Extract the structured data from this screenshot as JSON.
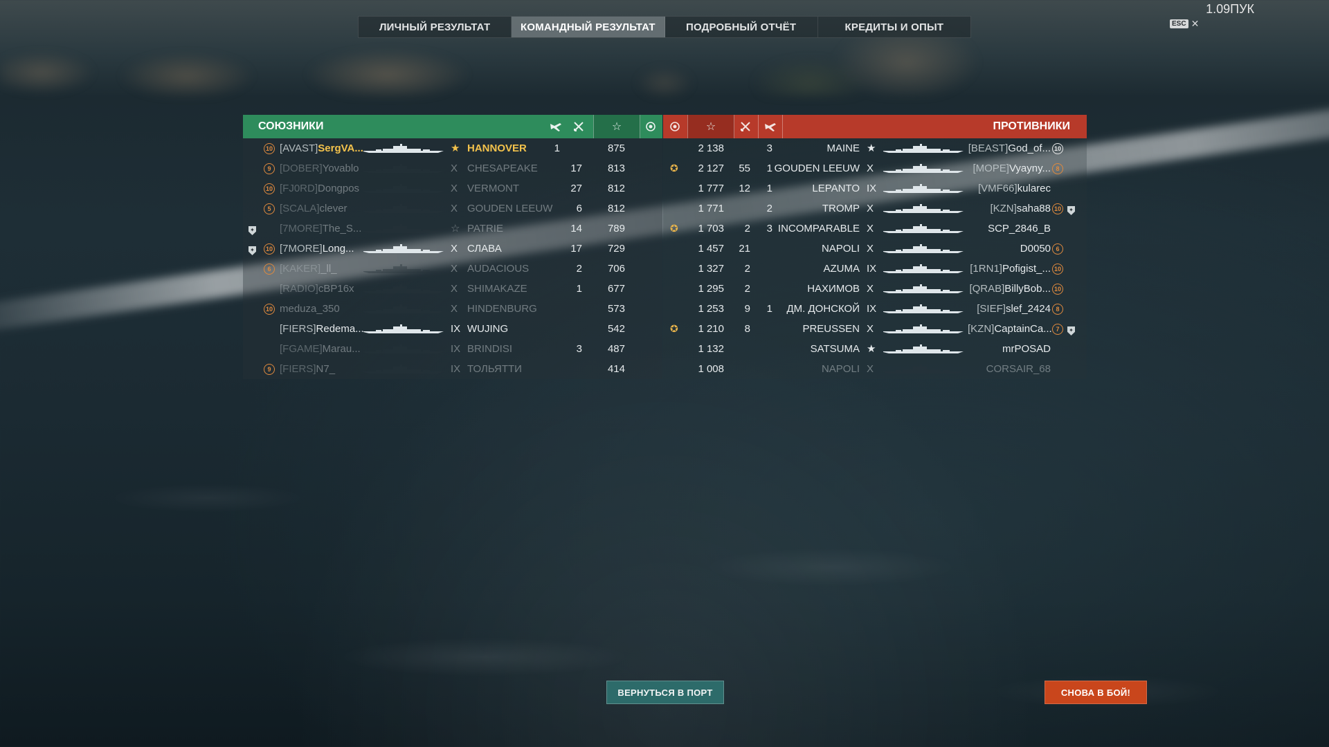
{
  "version": "1.09ПУК",
  "esc": {
    "label": "ESC",
    "close": "✕"
  },
  "tabs": [
    {
      "label": "ЛИЧНЫЙ РЕЗУЛЬТАТ",
      "active": false
    },
    {
      "label": "КОМАНДНЫЙ РЕЗУЛЬТАТ",
      "active": true
    },
    {
      "label": "ПОДРОБНЫЙ ОТЧЁТ",
      "active": false
    },
    {
      "label": "КРЕДИТЫ И ОПЫТ",
      "active": false
    }
  ],
  "allies": {
    "title": "СОЮЗНИКИ",
    "header_icons": [
      "plane-icon",
      "crossed-swords-icon",
      "star-icon",
      "wreath-icon"
    ],
    "rows": [
      {
        "level": "10",
        "clan": "[AVAST]",
        "name": "SergVA...",
        "tier": "★",
        "ship": "HANNOVER",
        "planes": "1",
        "kills": "",
        "xp": "875",
        "highlight": true,
        "alive": true
      },
      {
        "level": "9",
        "clan": "[DOBER]",
        "name": "Yovablo",
        "tier": "X",
        "ship": "CHESAPEAKE",
        "planes": "",
        "kills": "17",
        "xp": "813",
        "alive": false
      },
      {
        "level": "10",
        "clan": "[FJ0RD]",
        "name": "Dongpos",
        "tier": "X",
        "ship": "VERMONT",
        "planes": "",
        "kills": "27",
        "xp": "812",
        "alive": false
      },
      {
        "level": "5",
        "clan": "[SCALA]",
        "name": "clever",
        "tier": "X",
        "ship": "GOUDEN LEEUW",
        "planes": "",
        "kills": "6",
        "xp": "812",
        "alive": false
      },
      {
        "shield": true,
        "level": "",
        "clan": "[7MORE]",
        "name": "The_S...",
        "tier": "☆",
        "ship": "PATRIE",
        "planes": "",
        "kills": "14",
        "xp": "789",
        "alive": false
      },
      {
        "shield": true,
        "level": "10",
        "clan": "[7MORE]",
        "name": "Long...",
        "tier": "X",
        "ship": "СЛАВА",
        "planes": "",
        "kills": "17",
        "xp": "729",
        "alive": true
      },
      {
        "level": "6",
        "clan": "[KAKER]",
        "name": "_ll_",
        "tier": "X",
        "ship": "AUDACIOUS",
        "planes": "",
        "kills": "2",
        "xp": "706",
        "alive": false
      },
      {
        "level": "",
        "clan": "[RADIO]",
        "name": "cBP16x",
        "tier": "X",
        "ship": "SHIMAKAZE",
        "planes": "",
        "kills": "1",
        "xp": "677",
        "alive": false
      },
      {
        "level": "10",
        "clan": "",
        "name": "meduza_350",
        "tier": "X",
        "ship": "HINDENBURG",
        "planes": "",
        "kills": "",
        "xp": "573",
        "alive": false
      },
      {
        "level": "",
        "clan": "[FIERS]",
        "name": "Redema...",
        "tier": "IX",
        "ship": "WUJING",
        "planes": "",
        "kills": "",
        "xp": "542",
        "alive": true
      },
      {
        "level": "",
        "clan": "[FGAME]",
        "name": "Marau...",
        "tier": "IX",
        "ship": "BRINDISI",
        "planes": "",
        "kills": "3",
        "xp": "487",
        "alive": false
      },
      {
        "level": "9",
        "clan": "[FIERS]",
        "name": "N7_",
        "tier": "IX",
        "ship": "ТОЛЬЯТТИ",
        "planes": "",
        "kills": "",
        "xp": "414",
        "alive": false
      }
    ]
  },
  "enemies": {
    "title": "ПРОТИВНИКИ",
    "header_icons": [
      "wreath-icon",
      "star-icon",
      "crossed-swords-icon",
      "plane-icon"
    ],
    "rows": [
      {
        "wreath": false,
        "xp": "2 138",
        "kills": "",
        "planes": "3",
        "ship": "MAINE",
        "tier": "★",
        "clan": "[BEAST]",
        "name": "God_of...",
        "level": "10",
        "level_white": true,
        "alive": true
      },
      {
        "wreath": true,
        "xp": "2 127",
        "kills": "55",
        "planes": "1",
        "ship": "GOUDEN LEEUW",
        "tier": "X",
        "clan": "[MOPE]",
        "name": "Vyayny...",
        "level": "8",
        "alive": true
      },
      {
        "wreath": false,
        "xp": "1 777",
        "kills": "12",
        "planes": "1",
        "ship": "LEPANTO",
        "tier": "IX",
        "clan": "[VMF66]",
        "name": "kularec",
        "level": "",
        "alive": true
      },
      {
        "wreath": false,
        "xp": "1 771",
        "kills": "",
        "planes": "2",
        "ship": "TROMP",
        "tier": "X",
        "clan": "[KZN]",
        "name": "saha88",
        "level": "10",
        "shield": true,
        "alive": true
      },
      {
        "wreath": true,
        "xp": "1 703",
        "kills": "2",
        "planes": "3",
        "ship": "INCOMPARABLE",
        "tier": "X",
        "clan": "",
        "name": "SCP_2846_B",
        "level": "",
        "alive": true
      },
      {
        "wreath": false,
        "xp": "1 457",
        "kills": "21",
        "planes": "",
        "ship": "NAPOLI",
        "tier": "X",
        "clan": "",
        "name": "D0050",
        "level": "6",
        "alive": true
      },
      {
        "wreath": false,
        "xp": "1 327",
        "kills": "2",
        "planes": "",
        "ship": "AZUMA",
        "tier": "IX",
        "clan": "[1RN1]",
        "name": "Pofigist_...",
        "level": "10",
        "alive": true
      },
      {
        "wreath": false,
        "xp": "1 295",
        "kills": "2",
        "planes": "",
        "ship": "НАХИМОВ",
        "tier": "X",
        "clan": "[QRAB]",
        "name": "BillyBob...",
        "level": "10",
        "alive": true
      },
      {
        "wreath": false,
        "xp": "1 253",
        "kills": "9",
        "planes": "1",
        "ship": "ДМ. ДОНСКОЙ",
        "tier": "IX",
        "clan": "[SIEF]",
        "name": "slef_2424",
        "level": "8",
        "alive": true
      },
      {
        "wreath": true,
        "xp": "1 210",
        "kills": "8",
        "planes": "",
        "ship": "PREUSSEN",
        "tier": "X",
        "clan": "[KZN]",
        "name": "CaptainCa...",
        "level": "7",
        "shield": true,
        "alive": true
      },
      {
        "wreath": false,
        "xp": "1 132",
        "kills": "",
        "planes": "",
        "ship": "SATSUMA",
        "tier": "★",
        "clan": "",
        "name": "mrPOSAD",
        "level": "",
        "alive": true
      },
      {
        "wreath": false,
        "xp": "1 008",
        "kills": "",
        "planes": "",
        "ship": "NAPOLI",
        "tier": "X",
        "clan": "",
        "name": "CORSAIR_68",
        "level": "",
        "alive": false
      }
    ]
  },
  "buttons": {
    "port": "ВЕРНУТЬСЯ В ПОРТ",
    "battle": "СНОВА В БОЙ!"
  },
  "colors": {
    "allies": "#2e8c5c",
    "enemies": "#b73a2a",
    "battle_button": "#c9461c",
    "port_button": "#2d6b6a",
    "highlight": "#f3c24c"
  }
}
